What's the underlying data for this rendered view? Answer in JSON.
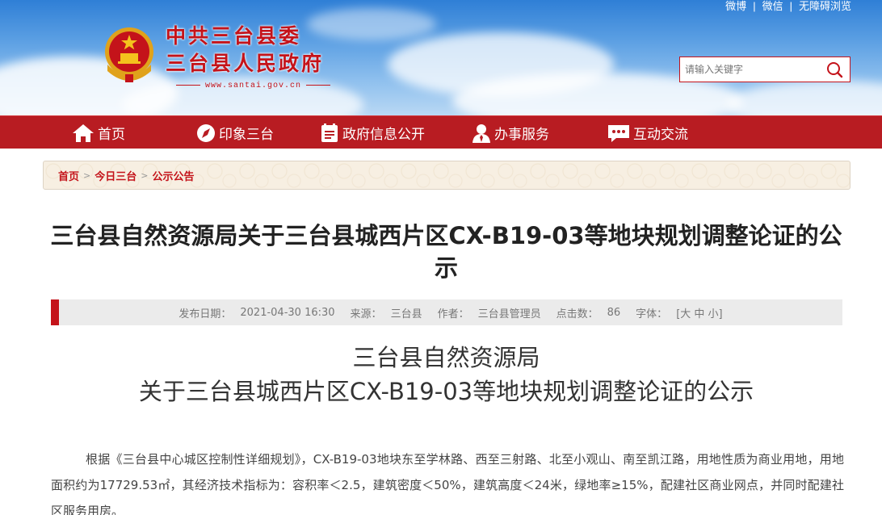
{
  "header": {
    "top_links": [
      "微博",
      "微信",
      "无障碍浏览"
    ],
    "site_title_line1": "中共三台县委",
    "site_title_line2": "三台县人民政府",
    "site_url": "www.santai.gov.cn",
    "search_placeholder": "请输入关键字"
  },
  "nav": {
    "items": [
      {
        "label": "首页",
        "icon": "home-icon"
      },
      {
        "label": "印象三台",
        "icon": "compass-icon"
      },
      {
        "label": "政府信息公开",
        "icon": "document-icon"
      },
      {
        "label": "办事服务",
        "icon": "user-icon"
      },
      {
        "label": "互动交流",
        "icon": "chat-icon"
      }
    ]
  },
  "breadcrumb": [
    "首页",
    "今日三台",
    "公示公告"
  ],
  "article": {
    "title": "三台县自然资源局关于三台县城西片区CX-B19-03等地块规划调整论证的公示",
    "meta": {
      "publish_label": "发布日期：",
      "publish_value": "2021-04-30 16:30",
      "source_label": "来源：",
      "source_value": "三台县",
      "author_label": "作者：",
      "author_value": "三台县管理员",
      "clicks_label": "点击数：",
      "clicks_value": "86",
      "font_label": "字体：",
      "font_value": "[大 中 小]"
    },
    "doc_head_line1": "三台县自然资源局",
    "doc_head_line2": "关于三台县城西片区CX-B19-03等地块规划调整论证的公示",
    "body": "根据《三台县中心城区控制性详细规划》，CX-B19-03地块东至学林路、西至三射路、北至小观山、南至凯江路，用地性质为商业用地，用地面积约为17729.53㎡，其经济技术指标为：容积率＜2.5，建筑密度＜50%，建筑高度＜24米，绿地率≥15%，配建社区商业网点，并同时配建社区服务用房。"
  },
  "colors": {
    "brand_red": "#b81c22",
    "title_red": "#c4131a"
  }
}
